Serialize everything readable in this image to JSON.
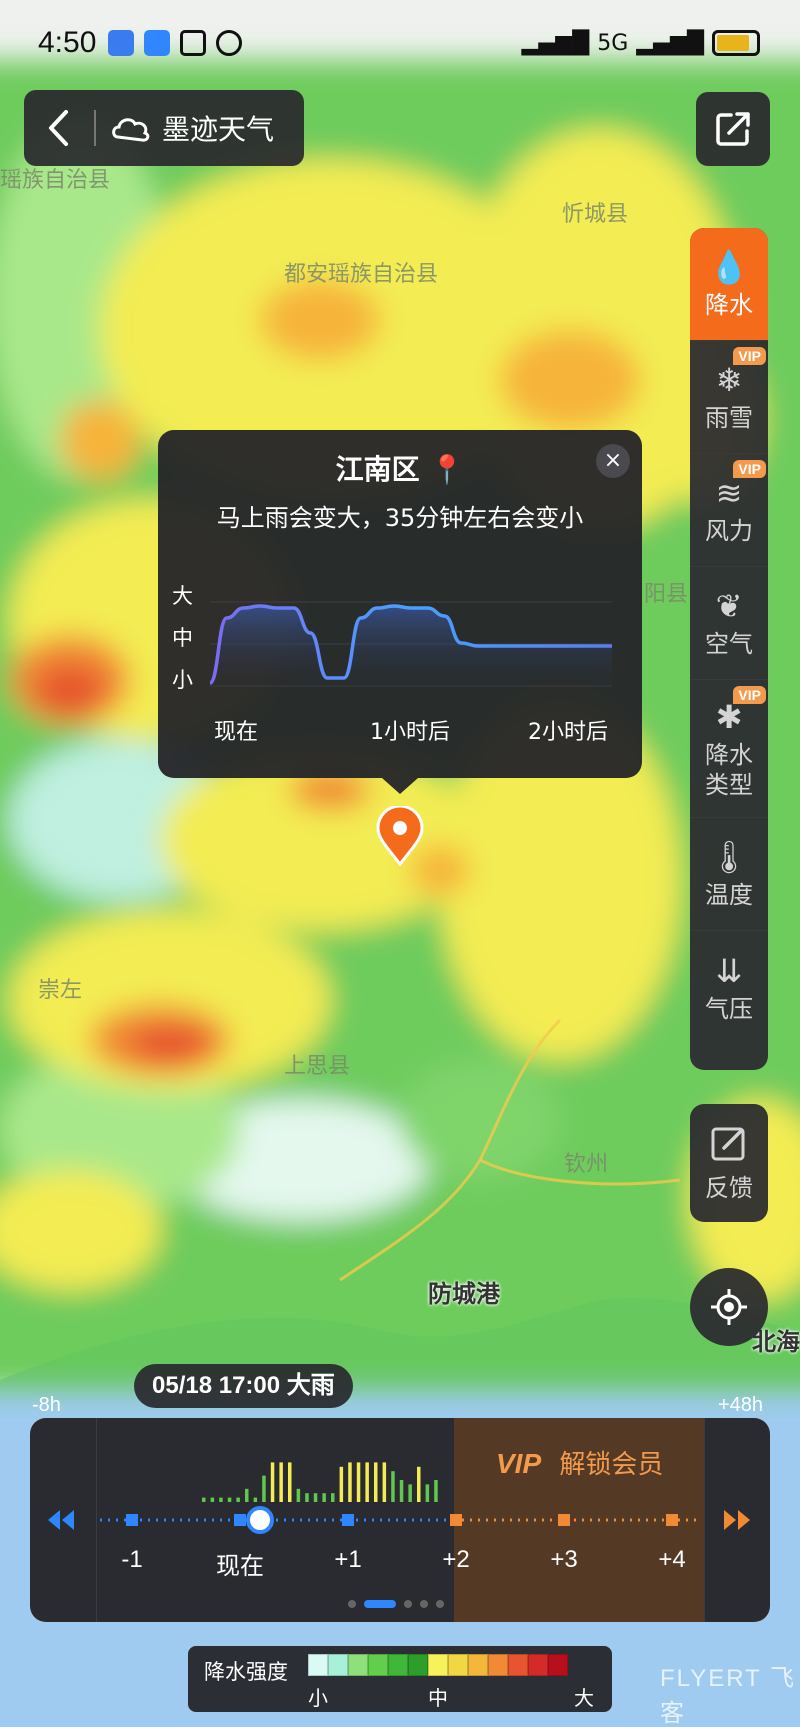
{
  "status_bar": {
    "time": "4:50",
    "signal_text": "5G"
  },
  "header": {
    "back_icon": "chevron-left-icon",
    "brand_icon": "cloud-logo-icon",
    "brand_name": "墨迹天气"
  },
  "map": {
    "places": [
      {
        "name": "瑶族自治县"
      },
      {
        "name": "忻城县"
      },
      {
        "name": "都安瑶族自治县"
      },
      {
        "name": "阳县"
      },
      {
        "name": "崇左"
      },
      {
        "name": "上思县"
      },
      {
        "name": "钦州"
      },
      {
        "name": "防城港"
      },
      {
        "name": "北海"
      }
    ]
  },
  "toolbar": {
    "items": [
      {
        "label": "降水",
        "icon": "precipitation-icon",
        "active": true,
        "vip": false
      },
      {
        "label": "雨雪",
        "icon": "rain-snow-icon",
        "active": false,
        "vip": true
      },
      {
        "label": "风力",
        "icon": "wind-icon",
        "active": false,
        "vip": true
      },
      {
        "label": "空气",
        "icon": "leaf-icon",
        "active": false,
        "vip": false
      },
      {
        "label": "降水\n类型",
        "icon": "precip-type-icon",
        "active": false,
        "vip": true
      },
      {
        "label": "温度",
        "icon": "thermometer-icon",
        "active": false,
        "vip": false
      },
      {
        "label": "气压",
        "icon": "pressure-icon",
        "active": false,
        "vip": false
      }
    ],
    "vip_tag": "VIP",
    "feedback_label": "反馈"
  },
  "popup": {
    "location": "江南区",
    "summary": "马上雨会变大，35分钟左右会变小",
    "close_label": "×",
    "y_labels": [
      "大",
      "中",
      "小"
    ],
    "x_labels": [
      "现在",
      "1小时后",
      "2小时后"
    ]
  },
  "chart_data": {
    "type": "area",
    "title": "",
    "xlabel": "",
    "ylabel": "",
    "x": [
      0,
      5,
      10,
      15,
      20,
      25,
      30,
      35,
      40,
      45,
      50,
      55,
      60,
      65,
      70,
      75,
      80,
      85,
      90,
      95,
      100,
      105,
      110,
      115,
      120
    ],
    "series": [
      {
        "values": [
          0.05,
          0.7,
          0.8,
          0.82,
          0.8,
          0.8,
          0.55,
          0.1,
          0.1,
          0.7,
          0.8,
          0.82,
          0.8,
          0.8,
          0.72,
          0.45,
          0.42,
          0.42,
          0.42,
          0.42,
          0.42,
          0.42,
          0.42,
          0.42,
          0.42
        ]
      }
    ],
    "y_categories": [
      "小",
      "中",
      "大"
    ],
    "ylim": [
      0,
      1
    ],
    "x_tick_labels": [
      "现在",
      "1小时后",
      "2小时后"
    ]
  },
  "time_chip": {
    "text": "05/18 17:00  大雨"
  },
  "timeline": {
    "left_edge": "-8h",
    "right_edge": "+48h",
    "ticks": [
      "-1",
      "现在",
      "+1",
      "+2",
      "+3",
      "+4"
    ],
    "vip_text": "解锁会员",
    "vip_badge": "VIP",
    "rewind_icon": "rewind-icon",
    "forward_icon": "fast-forward-icon",
    "bars": [
      0.1,
      0.1,
      0.1,
      0.1,
      0.1,
      0.3,
      0.1,
      0.6,
      0.9,
      0.9,
      0.9,
      0.3,
      0.2,
      0.2,
      0.2,
      0.2,
      0.8,
      0.9,
      0.9,
      0.9,
      0.9,
      0.9,
      0.7,
      0.5,
      0.4,
      0.8,
      0.4,
      0.5
    ]
  },
  "legend": {
    "title": "降水强度",
    "low": "小",
    "mid": "中",
    "high": "大",
    "colors": [
      "#d9fbf3",
      "#a9f0d8",
      "#8fe07a",
      "#62cf4c",
      "#3fb83a",
      "#2e9e2b",
      "#f6f25c",
      "#f2d744",
      "#f4b73a",
      "#f08a35",
      "#e6552f",
      "#d42a28",
      "#b80f1d"
    ]
  },
  "watermark": "FLYERT 飞客"
}
